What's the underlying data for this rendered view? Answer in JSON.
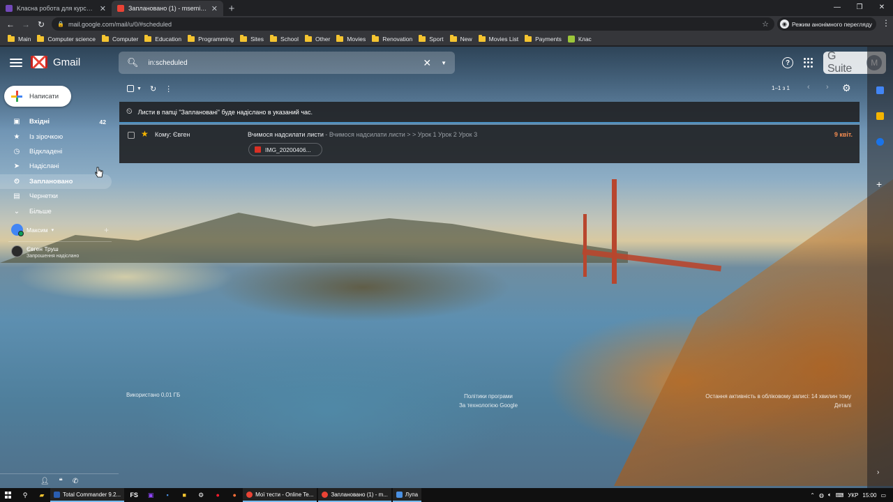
{
  "browser": {
    "tabs": [
      {
        "title": "Класна робота для курсу \"7Б. Ін",
        "favicon_color": "#7248b9",
        "active": false
      },
      {
        "title": "Заплановано (1) - msemianivsky",
        "favicon_color": "#ea4335",
        "active": true
      }
    ],
    "url": "mail.google.com/mail/u/0/#scheduled",
    "incognito_label": "Режим анонімного перегляду",
    "bookmarks": [
      "Main",
      "Computer science",
      "Computer",
      "Education",
      "Programming",
      "Sites",
      "School",
      "Other",
      "Movies",
      "Renovation",
      "Sport",
      "New",
      "Movies List",
      "Payments",
      "Клас"
    ]
  },
  "gmail": {
    "logo_text": "Gmail",
    "search_value": "in:scheduled",
    "gsuite_label": "G Suite",
    "avatar_letter": "M",
    "compose_label": "Написати",
    "nav": [
      {
        "label": "Вхідні",
        "icon": "inbox-icon",
        "count": "42",
        "bold": true
      },
      {
        "label": "Із зірочкою",
        "icon": "star-icon",
        "count": "",
        "bold": false
      },
      {
        "label": "Відкладені",
        "icon": "clock-icon",
        "count": "",
        "bold": false
      },
      {
        "label": "Надіслані",
        "icon": "send-icon",
        "count": "",
        "bold": false
      },
      {
        "label": "Заплановано",
        "icon": "scheduled-icon",
        "count": "",
        "bold": true,
        "selected": true
      },
      {
        "label": "Чернетки",
        "icon": "draft-icon",
        "count": "",
        "bold": false
      },
      {
        "label": "Більше",
        "icon": "chevron-down-icon",
        "count": "",
        "bold": false
      }
    ],
    "people": {
      "self_name": "Максим",
      "contact_name": "Євген Труш",
      "contact_status": "Запрошення надіслано"
    },
    "list": {
      "pager_text": "1–1 з 1",
      "banner_text": "Листи в папці \"Заплановані\" буде надіслано в указаний час.",
      "rows": [
        {
          "to": "Кому: Євген",
          "subject": "Вчимося надсилати листи",
          "snippet": " - Вчимося надсилати листи > > Урок 1 Урок 2 Урок 3",
          "date": "9 квіт.",
          "attachment": "IMG_20200406..."
        }
      ]
    },
    "footer": {
      "storage": "Використано 0,01 ГБ",
      "policy_line1": "Політики програми",
      "policy_line2": "За технологією Google",
      "activity_line1": "Остання активність в обліковому записі: 14 хвилин тому",
      "activity_line2": "Деталі"
    },
    "side_panel_colors": [
      "#4285f4",
      "#f4b400",
      "#1a73e8"
    ]
  },
  "taskbar": {
    "apps": [
      {
        "label": "Total Commander 9.2...",
        "color": "#2a5db0"
      },
      {
        "label": "Мої тести - Online Te...",
        "color": "#ea4335"
      },
      {
        "label": "Заплановано (1) - m...",
        "color": "#ea4335"
      },
      {
        "label": "Лупа",
        "color": "#4a90e2"
      }
    ],
    "tray_lang": "УКР",
    "time": "15:00"
  }
}
